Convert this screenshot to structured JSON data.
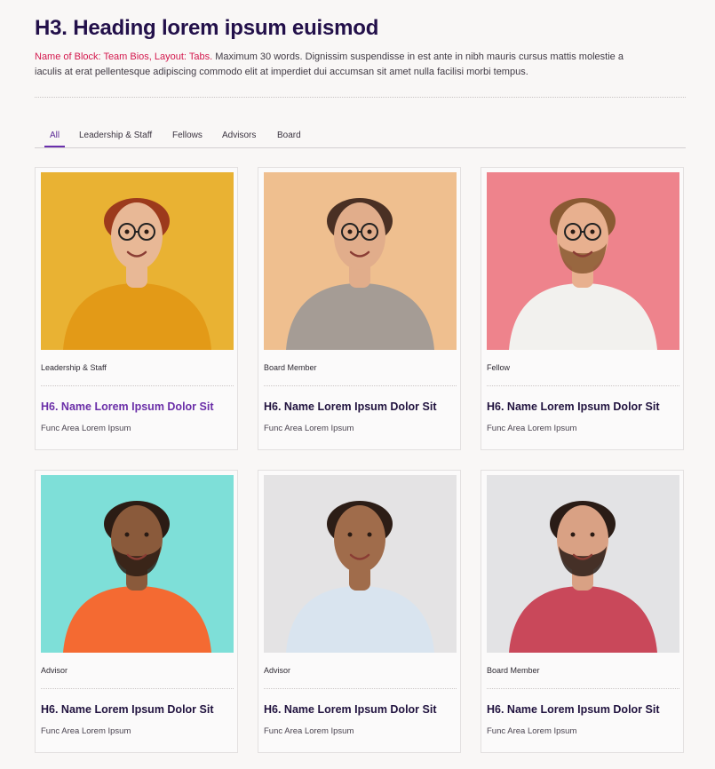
{
  "header": {
    "title": "H3. Heading lorem ipsum euismod",
    "intro_accent": "Name of Block: Team Bios, Layout: Tabs.",
    "intro_text": " Maximum 30 words. Dignissim suspendisse in est ante in nibh mauris cursus mattis molestie a iaculis at erat pellentesque adipiscing commodo elit at imperdiet dui accumsan sit amet nulla facilisi morbi tempus."
  },
  "tabs": [
    {
      "label": "All",
      "active": true
    },
    {
      "label": "Leadership & Staff",
      "active": false
    },
    {
      "label": "Fellows",
      "active": false
    },
    {
      "label": "Advisors",
      "active": false
    },
    {
      "label": "Board",
      "active": false
    }
  ],
  "cards": [
    {
      "category": "Leadership & Staff",
      "name": "H6. Name Lorem Ipsum Dolor Sit",
      "func": "Func Area Lorem Ipsum",
      "bg": "#e9b233",
      "shirt": "#e39a17",
      "hair": "#9c3a1c",
      "skin": "#e8b896",
      "glasses": true,
      "beard": false
    },
    {
      "category": "Board Member",
      "name": "H6. Name Lorem Ipsum Dolor Sit",
      "func": "Func Area Lorem Ipsum",
      "bg": "#efbf8f",
      "shirt": "#a59c95",
      "hair": "#4a3024",
      "skin": "#e1ad8b",
      "glasses": true,
      "beard": false
    },
    {
      "category": "Fellow",
      "name": "H6. Name Lorem Ipsum Dolor Sit",
      "func": "Func Area Lorem Ipsum",
      "bg": "#ee838c",
      "shirt": "#f2f1ee",
      "hair": "#8a5a33",
      "skin": "#e8b08f",
      "glasses": true,
      "beard": true
    },
    {
      "category": "Advisor",
      "name": "H6. Name Lorem Ipsum Dolor Sit",
      "func": "Func Area Lorem Ipsum",
      "bg": "#7edfd8",
      "shirt": "#f46a32",
      "hair": "#2b1c14",
      "skin": "#8a5a3b",
      "glasses": false,
      "beard": true
    },
    {
      "category": "Advisor",
      "name": "H6. Name Lorem Ipsum Dolor Sit",
      "func": "Func Area Lorem Ipsum",
      "bg": "#e4e3e4",
      "shirt": "#d9e4ef",
      "hair": "#2c1d16",
      "skin": "#a06c4b",
      "glasses": false,
      "beard": false
    },
    {
      "category": "Board Member",
      "name": "H6. Name Lorem Ipsum Dolor Sit",
      "func": "Func Area Lorem Ipsum",
      "bg": "#e3e3e5",
      "shirt": "#c9485a",
      "hair": "#2a1c16",
      "skin": "#d9a184",
      "glasses": false,
      "beard": true
    }
  ]
}
